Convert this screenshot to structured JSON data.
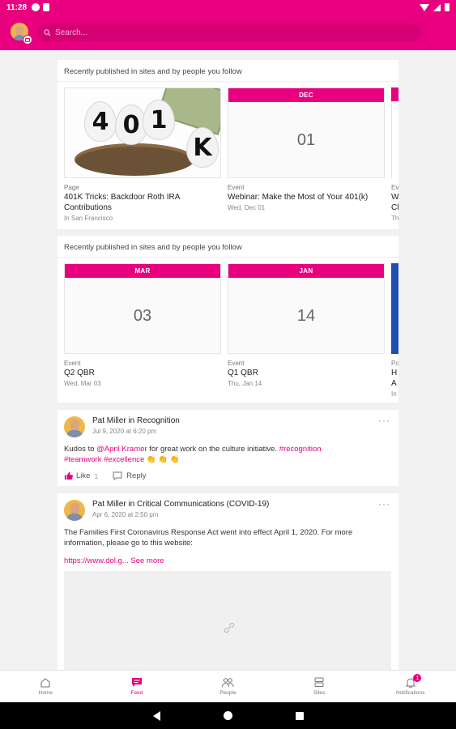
{
  "status_bar": {
    "time": "11:28"
  },
  "search": {
    "placeholder": "Search..."
  },
  "feed": {
    "sections": [
      {
        "title": "Recently published in sites and by people you follow",
        "tiles": [
          {
            "type": "Page",
            "name": "401K Tricks: Backdoor Roth IRA Contributions",
            "sub": "In San Francisco",
            "image_eggs": [
              "4",
              "0",
              "1",
              "K"
            ]
          },
          {
            "type": "Event",
            "month": "DEC",
            "day": "01",
            "name": "Webinar: Make the Most of Your 401(k)",
            "sub": "Wed, Dec 01"
          }
        ],
        "peek": {
          "type": "Ev",
          "name": "W",
          "name2": "Cl",
          "sub": "Th"
        }
      },
      {
        "title": "Recently published in sites and by people you follow",
        "tiles": [
          {
            "type": "Event",
            "month": "MAR",
            "day": "03",
            "name": "Q2 QBR",
            "sub": "Wed, Mar 03"
          },
          {
            "type": "Event",
            "month": "JAN",
            "day": "14",
            "name": "Q1 QBR",
            "sub": "Thu, Jan 14"
          }
        ],
        "peek": {
          "type": "Po",
          "name": "H",
          "name2": "A",
          "sub": "In"
        }
      }
    ],
    "posts": [
      {
        "author": "Pat Miller in Recognition",
        "time": "Jul 9, 2020 at 6:20 pm",
        "body_pre": "Kudos to ",
        "mention": "@April Kramer",
        "body_mid": " for great work on the culture initiative. ",
        "tag1": "#recognition",
        "tag2": "#teamwork",
        "tag3": "#excellence",
        "emoji": "👏 👏 👏",
        "like_label": "Like",
        "like_count": "1",
        "reply_label": "Reply"
      },
      {
        "author": "Pat Miller in Critical Communications (COVID-19)",
        "time": "Apr 6, 2020 at 2:50 pm",
        "body": "The Families First Coronavirus Response Act went into effect April 1, 2020. For more information, please go to this website:",
        "link": "https://www.dol.g...",
        "see_more": "See more"
      }
    ]
  },
  "bottom_nav": {
    "home": "Home",
    "feed": "Feed",
    "people": "People",
    "sites": "Sites",
    "notifications": "Notifications",
    "notif_count": "1"
  },
  "colors": {
    "brand": "#e8007f",
    "background": "#f1f1f1"
  }
}
